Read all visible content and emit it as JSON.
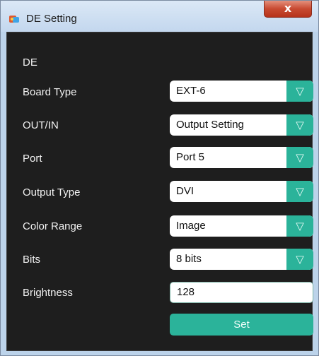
{
  "window": {
    "title": "DE Setting",
    "close_label": "x"
  },
  "section": {
    "label": "DE"
  },
  "fields": {
    "board_type": {
      "label": "Board Type",
      "value": "EXT-6"
    },
    "out_in": {
      "label": "OUT/IN",
      "value": "Output Setting"
    },
    "port": {
      "label": "Port",
      "value": "Port 5"
    },
    "output_type": {
      "label": "Output Type",
      "value": "DVI"
    },
    "color_range": {
      "label": "Color Range",
      "value": "Image"
    },
    "bits": {
      "label": "Bits",
      "value": "8 bits"
    },
    "brightness": {
      "label": "Brightness",
      "value": "128"
    }
  },
  "dropdown_arrow": "▽",
  "set_label": "Set",
  "colors": {
    "accent": "#2bb39a",
    "panel": "#1e1e1e",
    "close": "#c84a31"
  }
}
